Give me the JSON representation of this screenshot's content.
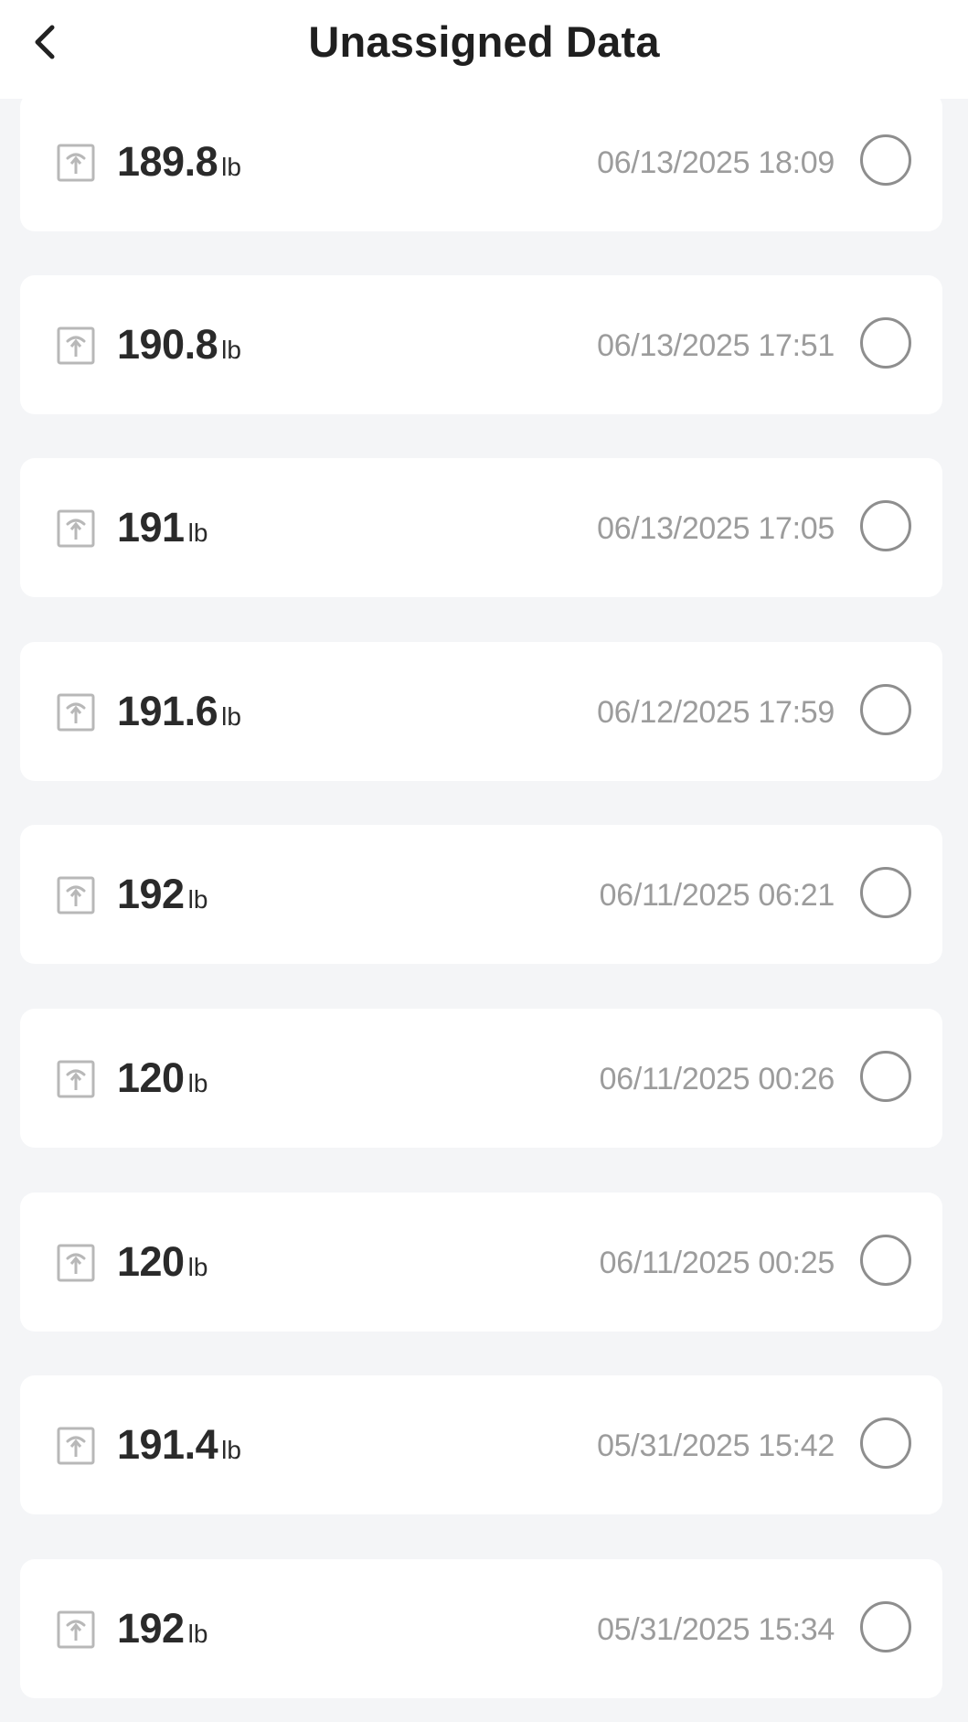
{
  "header": {
    "title": "Unassigned Data",
    "back_icon": "chevron-left-icon"
  },
  "records": [
    {
      "weight": "189.8",
      "unit": "lb",
      "timestamp": "06/13/2025 18:09",
      "selected": false
    },
    {
      "weight": "190.8",
      "unit": "lb",
      "timestamp": "06/13/2025 17:51",
      "selected": false
    },
    {
      "weight": "191",
      "unit": "lb",
      "timestamp": "06/13/2025 17:05",
      "selected": false
    },
    {
      "weight": "191.6",
      "unit": "lb",
      "timestamp": "06/12/2025 17:59",
      "selected": false
    },
    {
      "weight": "192",
      "unit": "lb",
      "timestamp": "06/11/2025 06:21",
      "selected": false
    },
    {
      "weight": "120",
      "unit": "lb",
      "timestamp": "06/11/2025 00:26",
      "selected": false
    },
    {
      "weight": "120",
      "unit": "lb",
      "timestamp": "06/11/2025 00:25",
      "selected": false
    },
    {
      "weight": "191.4",
      "unit": "lb",
      "timestamp": "05/31/2025 15:42",
      "selected": false
    },
    {
      "weight": "192",
      "unit": "lb",
      "timestamp": "05/31/2025 15:34",
      "selected": false
    }
  ],
  "colors": {
    "background": "#f4f5f7",
    "card": "#ffffff",
    "text_primary": "#2a2a2a",
    "text_secondary": "#9c9c9c"
  }
}
